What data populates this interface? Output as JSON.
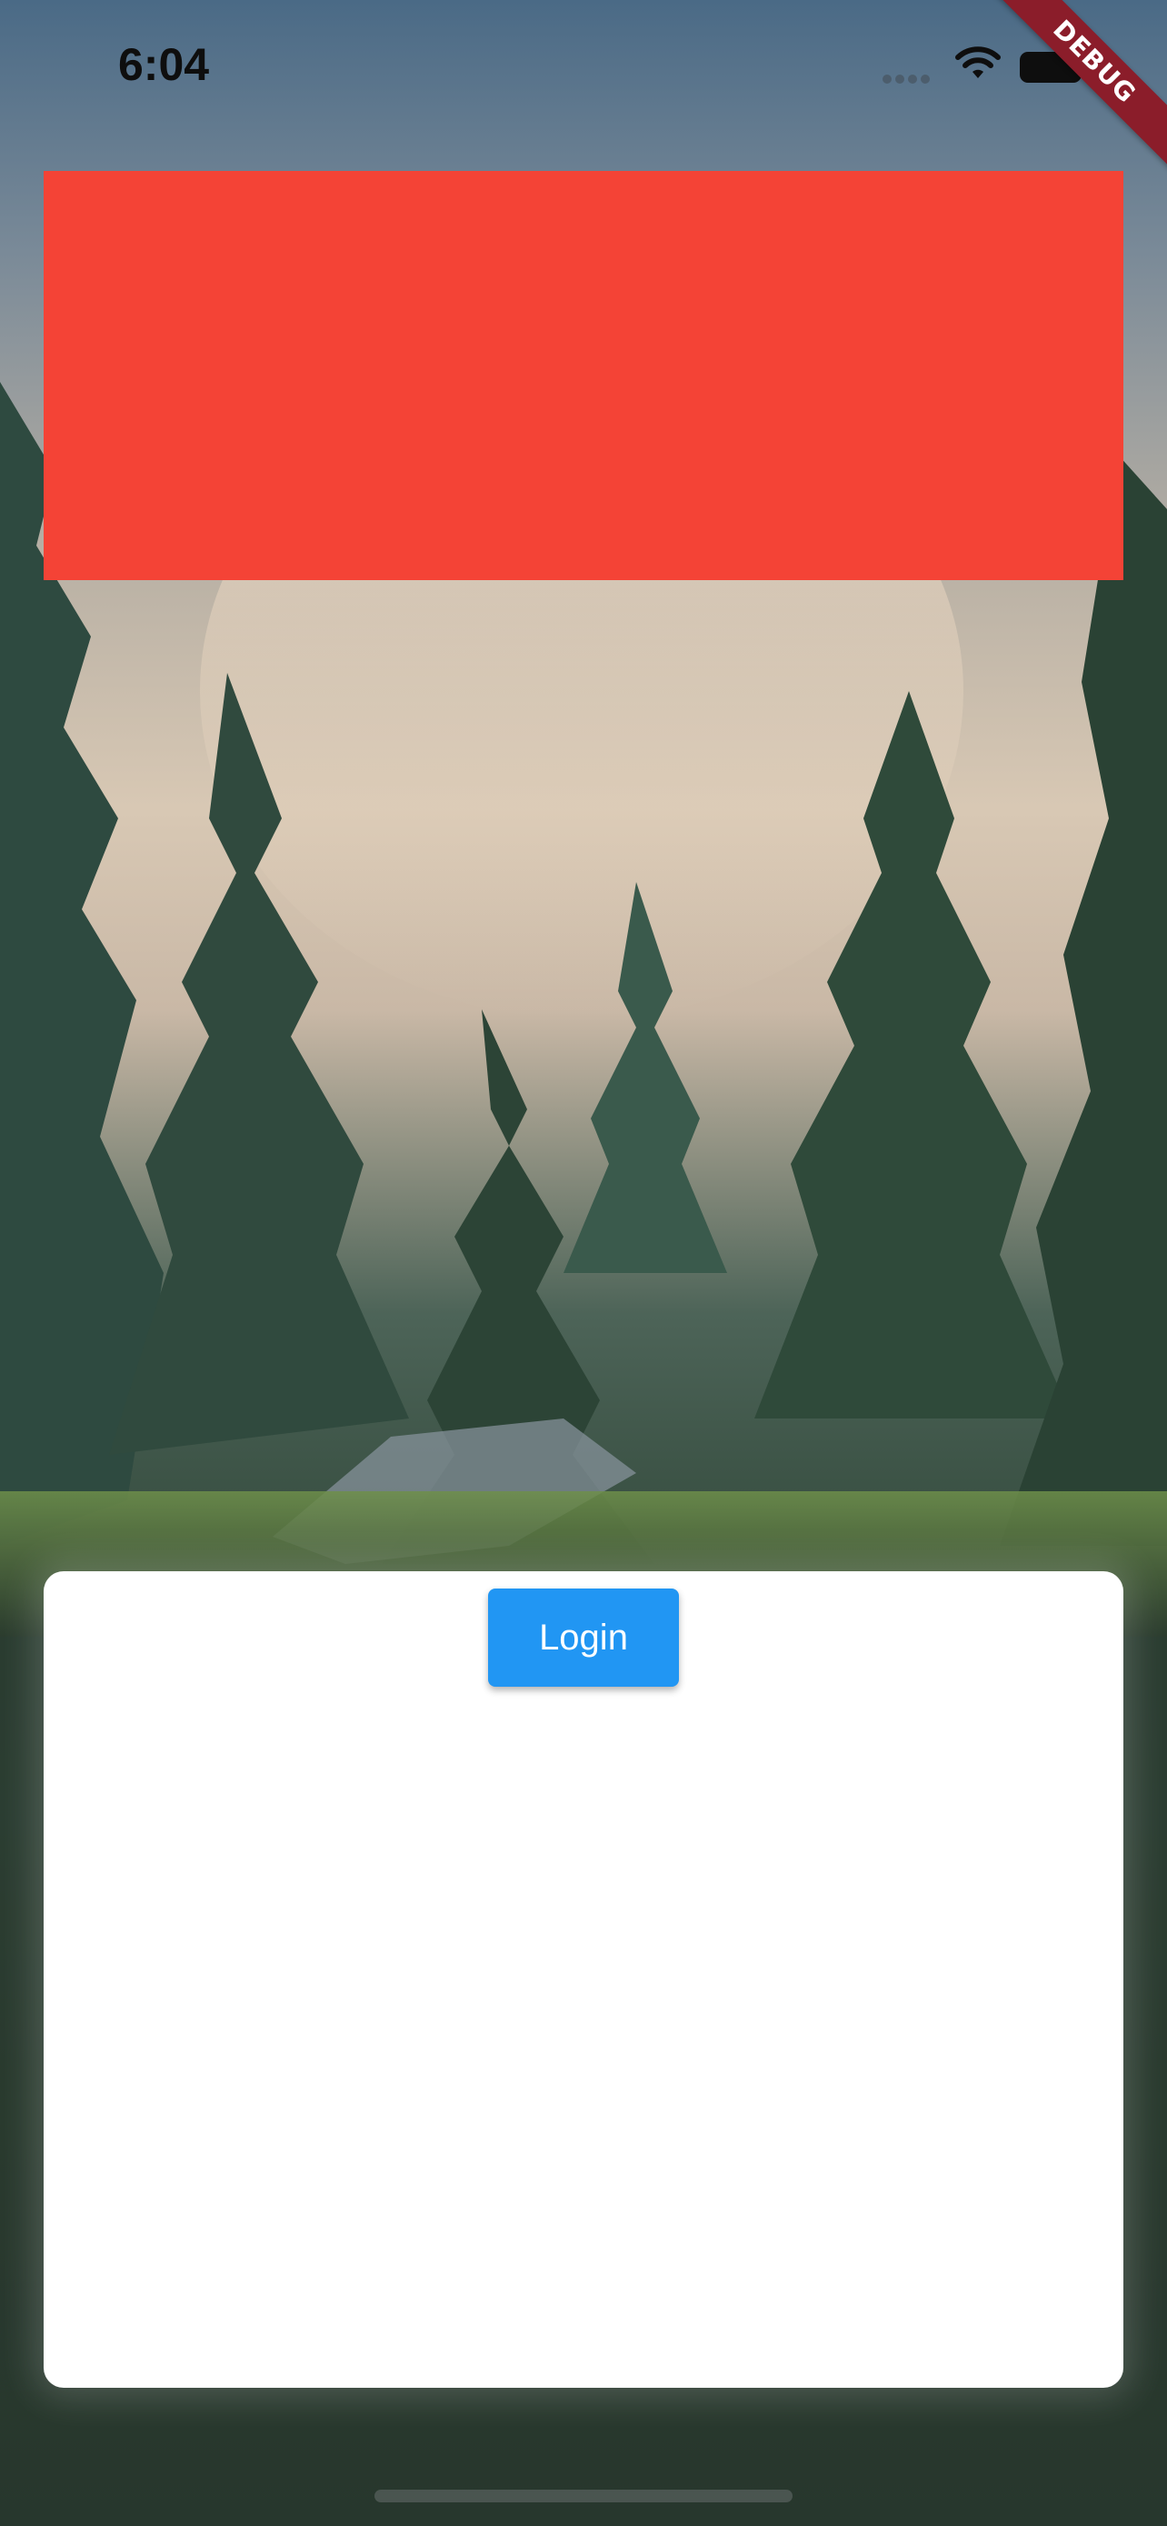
{
  "status_bar": {
    "time": "6:04",
    "signal_icon": "cellular-signal-icon",
    "wifi_icon": "wifi-icon",
    "battery_icon": "battery-icon"
  },
  "debug_banner": {
    "label": "DEBUG"
  },
  "banner": {
    "color": "#f44336"
  },
  "login_card": {
    "button_label": "Login",
    "button_color": "#2196f3"
  },
  "colors": {
    "debug_ribbon": "#8b1d2a",
    "card_background": "#ffffff"
  }
}
